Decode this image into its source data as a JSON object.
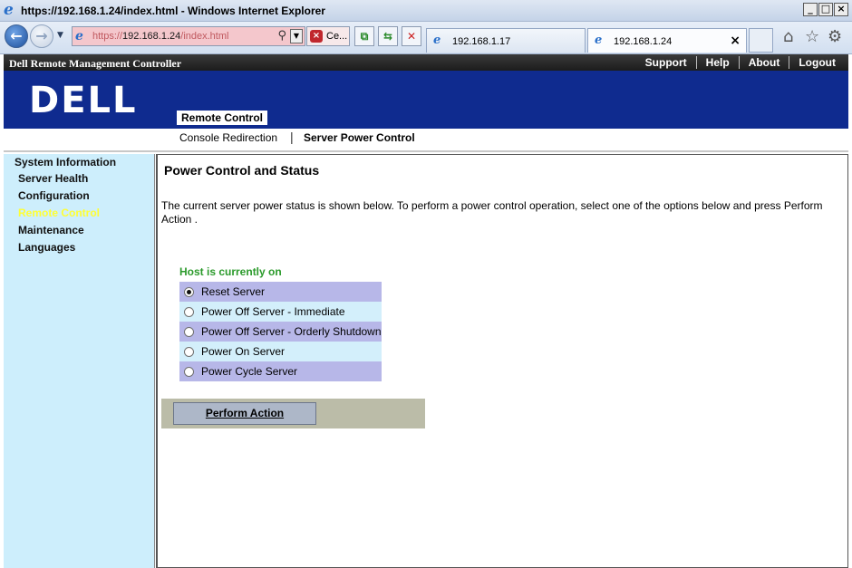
{
  "window": {
    "title": "https://192.168.1.24/index.html - Windows Internet Explorer",
    "controls": {
      "minimize": "_",
      "maximize": "□",
      "close": "×"
    }
  },
  "browser": {
    "address": {
      "prefix": "https://",
      "host": "192.168.1.24",
      "path": "/index.html"
    },
    "cert_label": "Ce...",
    "tabs": [
      {
        "label": "192.168.1.17",
        "active": false
      },
      {
        "label": "192.168.1.24",
        "active": true
      }
    ],
    "tab_close": "×",
    "icons": [
      "back-icon",
      "forward-icon",
      "search-icon",
      "cert-error-icon",
      "compat-view-icon",
      "refresh-icon",
      "stop-icon",
      "home-icon",
      "favorites-icon",
      "tools-icon"
    ]
  },
  "app": {
    "title": "Dell Remote Management Controller",
    "links": [
      "Support",
      "Help",
      "About",
      "Logout"
    ],
    "logo": "DELL",
    "active_tab": "Remote Control",
    "subnav": {
      "console": "Console Redirection",
      "separator": "|",
      "power": "Server Power Control"
    },
    "colors": {
      "banner": "#0f2b8f",
      "sidebar": "#cdeefc",
      "active_nav": "#ffff33",
      "status": "#2b9a2b"
    }
  },
  "sidebar": {
    "items": [
      {
        "label": "System Information"
      },
      {
        "label": "Server Health"
      },
      {
        "label": "Configuration"
      },
      {
        "label": "Remote Control",
        "active": true
      },
      {
        "label": "Maintenance"
      },
      {
        "label": "Languages"
      }
    ]
  },
  "main": {
    "heading": "Power Control and Status",
    "description": "The current server power status is shown below. To perform a power control operation, select one of the options below and press Perform Action .",
    "status": "Host is currently on",
    "options": [
      {
        "label": "Reset Server",
        "checked": true
      },
      {
        "label": "Power Off Server - Immediate",
        "checked": false
      },
      {
        "label": "Power Off Server - Orderly Shutdown",
        "checked": false
      },
      {
        "label": "Power On Server",
        "checked": false
      },
      {
        "label": "Power Cycle Server",
        "checked": false
      }
    ],
    "action_button": "Perform Action"
  }
}
